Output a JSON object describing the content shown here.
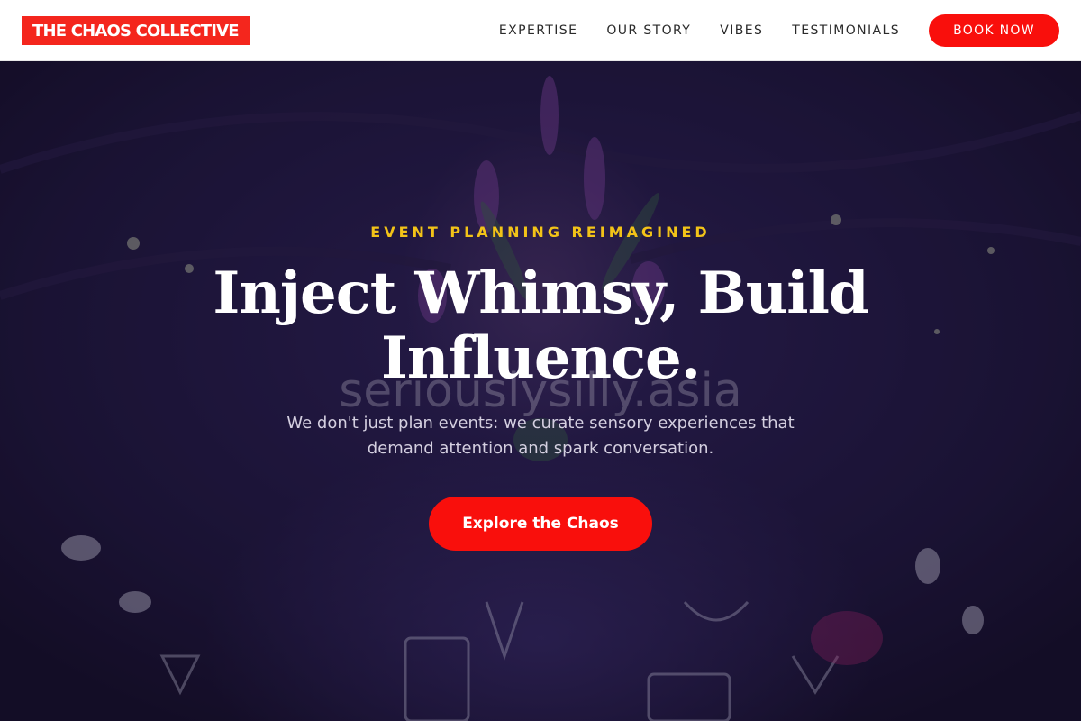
{
  "brand": {
    "name": "THE CHAOS COLLECTIVE",
    "accent_color": "#f4261d"
  },
  "nav": {
    "links": [
      {
        "label": "EXPERTISE"
      },
      {
        "label": "OUR STORY"
      },
      {
        "label": "VIBES"
      },
      {
        "label": "TESTIMONIALS"
      }
    ],
    "cta_label": "BOOK NOW",
    "cta_color": "#f90f0c"
  },
  "hero": {
    "eyebrow": "EVENT PLANNING REIMAGINED",
    "eyebrow_color": "#f2c318",
    "headline": "Inject Whimsy, Build Influence.",
    "watermark": "seriouslysilly.asia",
    "subtitle": "We don't just plan events: we curate sensory experiences that demand attention and spark conversation.",
    "cta_label": "Explore the Chaos",
    "background_image": "event-table-centerpiece-photo"
  }
}
